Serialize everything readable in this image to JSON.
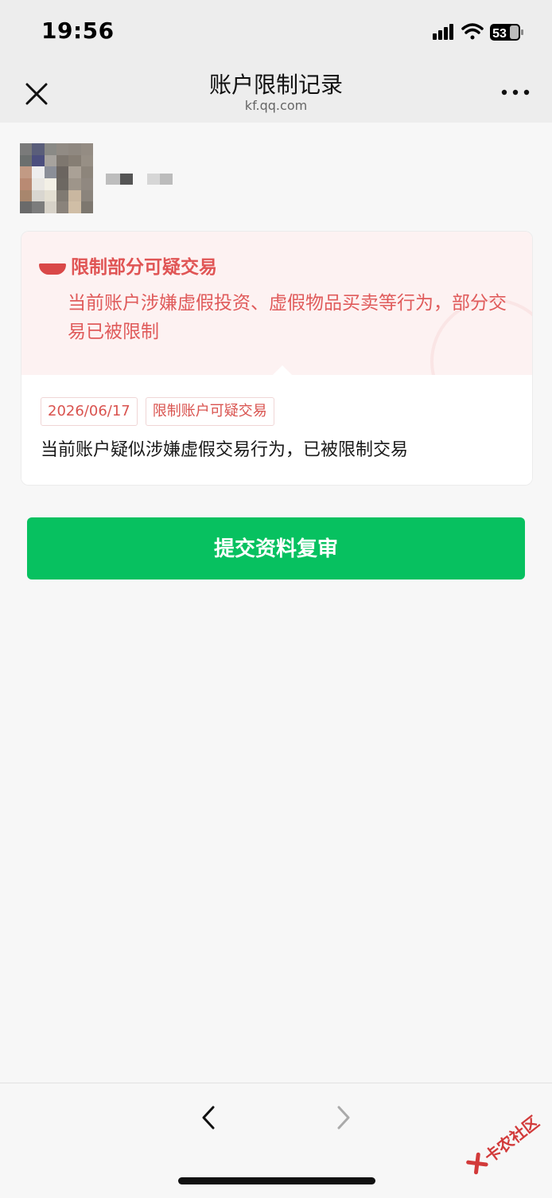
{
  "status_bar": {
    "time": "19:56",
    "battery": "53"
  },
  "nav": {
    "title": "账户限制记录",
    "subtitle": "kf.qq.com"
  },
  "notice": {
    "title": "限制部分可疑交易",
    "description": "当前账户涉嫌虚假投资、虚假物品买卖等行为，部分交易已被限制"
  },
  "record": {
    "date": "2026/06/17",
    "type": "限制账户可疑交易",
    "detail": "当前账户疑似涉嫌虚假交易行为，已被限制交易"
  },
  "actions": {
    "submit_label": "提交资料复审"
  },
  "watermark": {
    "text": "卡农社区"
  },
  "colors": {
    "primary": "#07c160",
    "alert_text": "#e05b5b",
    "alert_bg": "#fdf2f2"
  },
  "icons": [
    "close-icon",
    "more-icon",
    "signal-icon",
    "wifi-icon",
    "battery-icon",
    "back-icon",
    "forward-icon"
  ]
}
